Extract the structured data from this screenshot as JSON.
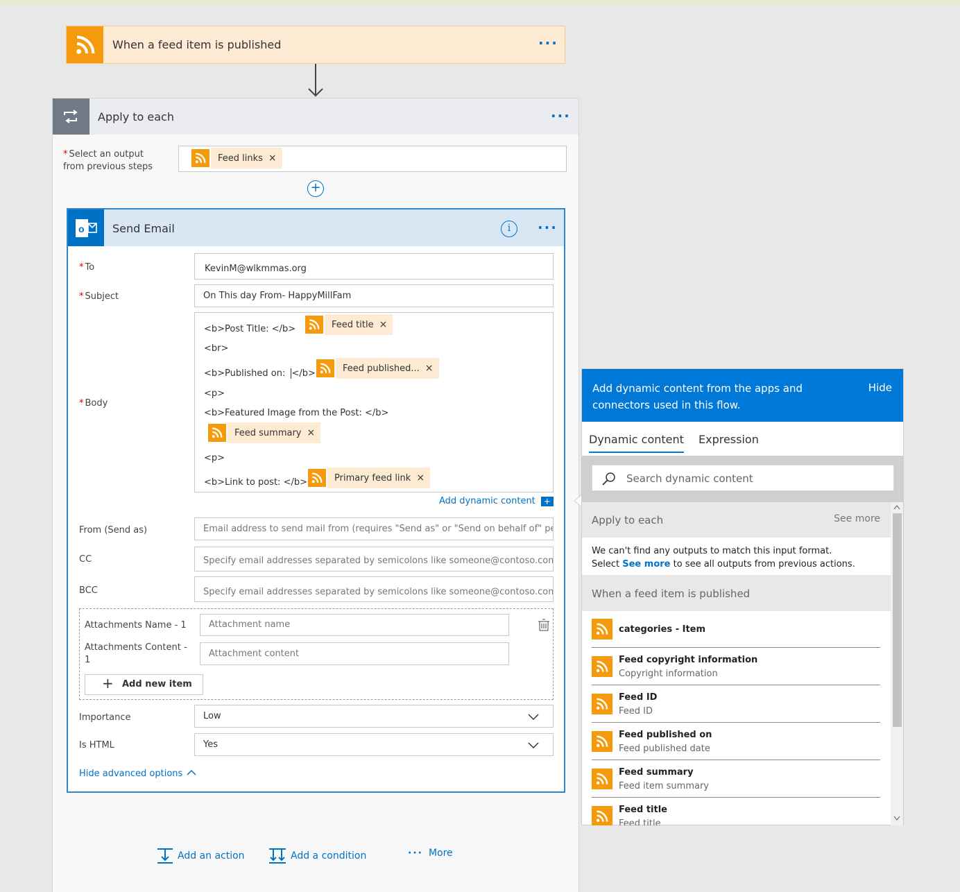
{
  "trigger": {
    "title": "When a feed item is published",
    "icon": "rss-icon"
  },
  "apply": {
    "title": "Apply to each",
    "select_label": "Select an output",
    "select_label2": "from previous steps",
    "token": "Feed links"
  },
  "send": {
    "title": "Send Email",
    "to_label": "To",
    "to_value": "KevinM@wlkmmas.org",
    "subject_label": "Subject",
    "subject_value": "On This day From- HappyMillFam",
    "body_label": "Body",
    "body": {
      "l1": "<b>Post Title:  </b>",
      "t1": "Feed title",
      "l2": "<br>",
      "l3a": "<b>Published on: ",
      "l3b": "</b>",
      "t2": "Feed published...",
      "l4": "<p>",
      "l5": "<b>Featured Image from the Post: </b>",
      "t3": "Feed summary",
      "l6": "<p>",
      "l7": "<b>Link to post: </b>",
      "t4": "Primary feed link"
    },
    "add_dynamic": "Add dynamic content",
    "from_label": "From (Send as)",
    "from_placeholder": "Email address to send mail from (requires \"Send as\" or \"Send on behalf of\" pe",
    "cc_label": "CC",
    "cc_placeholder": "Specify email addresses separated by semicolons like someone@contoso.com",
    "bcc_label": "BCC",
    "bcc_placeholder": "Specify email addresses separated by semicolons like someone@contoso.com",
    "att_name_label": "Attachments Name - 1",
    "att_name_placeholder": "Attachment name",
    "att_content_label": "Attachments Content -",
    "att_content_label2": "1",
    "att_content_placeholder": "Attachment content",
    "add_item": "Add new item",
    "importance_label": "Importance",
    "importance_value": "Low",
    "ishtml_label": "Is HTML",
    "ishtml_value": "Yes",
    "hide_adv": "Hide advanced options"
  },
  "bottom": {
    "add_action": "Add an action",
    "add_condition": "Add a condition",
    "more": "More"
  },
  "dynamic": {
    "header": "Add dynamic content from the apps and connectors used in this flow.",
    "hide": "Hide",
    "tab1": "Dynamic content",
    "tab2": "Expression",
    "search_placeholder": "Search dynamic content",
    "sec1": "Apply to each",
    "see_more": "See more",
    "msg1": "We can't find any outputs to match this input format.",
    "msg2a": "Select ",
    "msg2b": "See more",
    "msg2c": " to see all outputs from previous actions.",
    "sec2": "When a feed item is published",
    "items": [
      {
        "name": "categories - Item",
        "desc": ""
      },
      {
        "name": "Feed copyright information",
        "desc": "Copyright information"
      },
      {
        "name": "Feed ID",
        "desc": "Feed ID"
      },
      {
        "name": "Feed published on",
        "desc": "Feed published date"
      },
      {
        "name": "Feed summary",
        "desc": "Feed item summary"
      },
      {
        "name": "Feed title",
        "desc": "Feed title"
      }
    ]
  },
  "colors": {
    "accent": "#0072c6",
    "rss": "#f59a0c",
    "panel_header": "#0078d7"
  }
}
